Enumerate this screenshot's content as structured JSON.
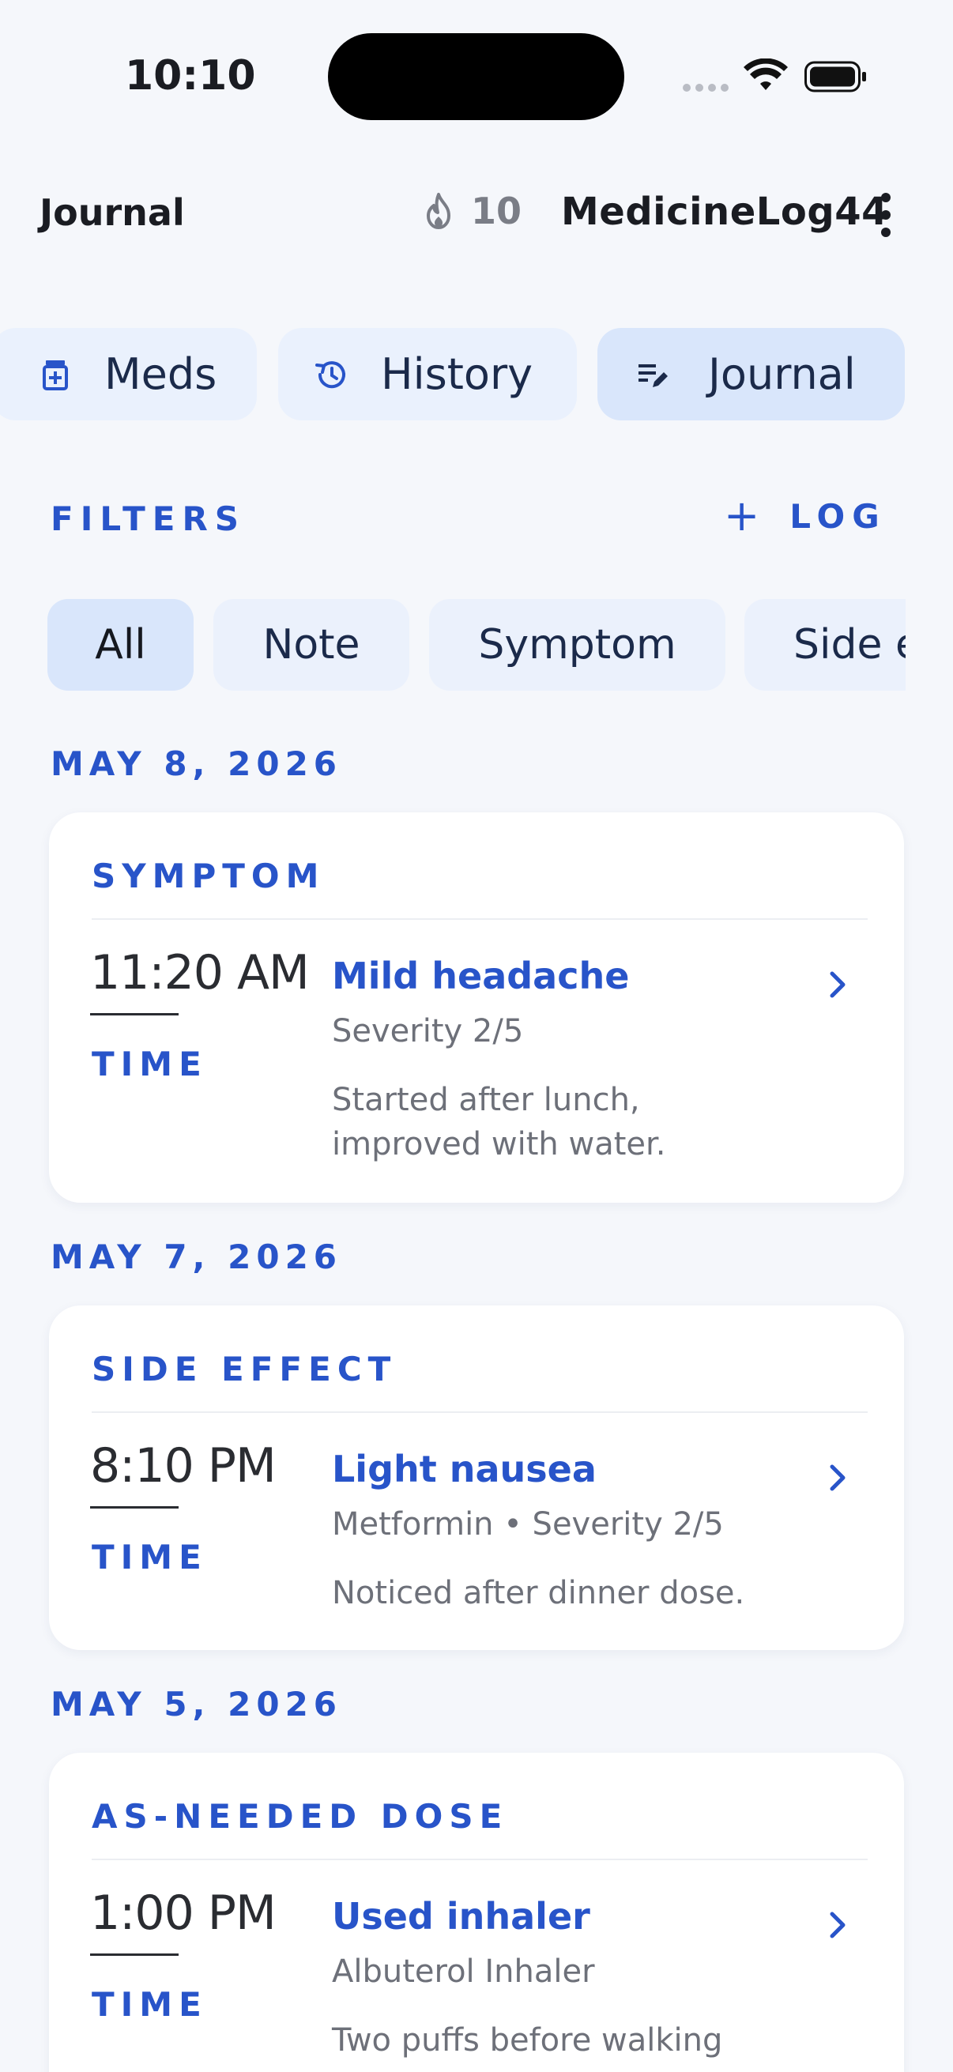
{
  "status_bar": {
    "time": "10:10"
  },
  "header": {
    "title": "Journal",
    "streak_count": "10",
    "username": "MedicineLog44"
  },
  "tabs": [
    {
      "label": "Meds",
      "icon": "pill-bottle-icon",
      "active": false
    },
    {
      "label": "History",
      "icon": "history-icon",
      "active": false
    },
    {
      "label": "Journal",
      "icon": "journal-edit-icon",
      "active": true
    }
  ],
  "filters": {
    "label": "FILTERS",
    "log_label": "LOG",
    "chips": [
      {
        "label": "All",
        "active": true
      },
      {
        "label": "Note",
        "active": false
      },
      {
        "label": "Symptom",
        "active": false
      },
      {
        "label": "Side effect",
        "active": false
      }
    ]
  },
  "entries": [
    {
      "date": "MAY 8, 2026",
      "type": "SYMPTOM",
      "time": "11:20 AM",
      "time_label": "TIME",
      "title": "Mild headache",
      "meta": "Severity 2/5",
      "note": "Started after lunch, improved with water."
    },
    {
      "date": "MAY 7, 2026",
      "type": "SIDE EFFECT",
      "time": "8:10 PM",
      "time_label": "TIME",
      "title": "Light nausea",
      "meta": "Metformin • Severity 2/5",
      "note": "Noticed after dinner dose."
    },
    {
      "date": "MAY 5, 2026",
      "type": "AS-NEEDED DOSE",
      "time": "1:00 PM",
      "time_label": "TIME",
      "title": "Used inhaler",
      "meta": "Albuterol Inhaler",
      "note": "Two puffs before walking"
    }
  ],
  "colors": {
    "accent": "#2854c9",
    "background": "#f5f7fb",
    "chip": "#ebf1fc",
    "chip_active": "#d9e6fb"
  }
}
